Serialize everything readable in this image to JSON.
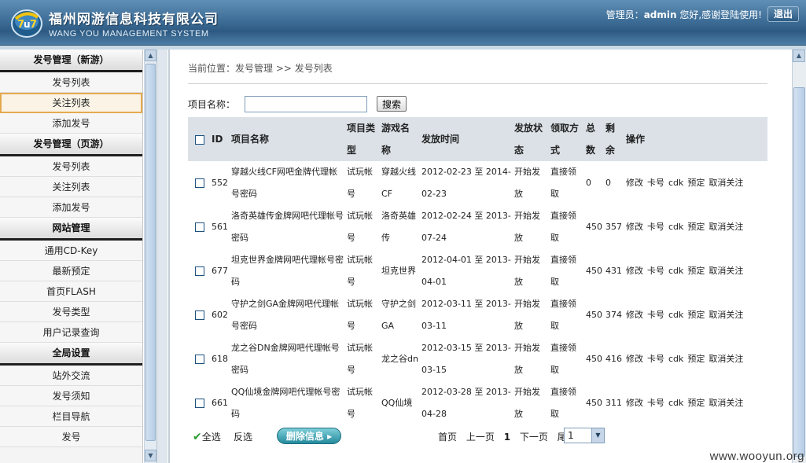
{
  "header": {
    "title": "福州网游信息科技有限公司",
    "subtitle": "WANG YOU MANAGEMENT SYSTEM",
    "admin_prefix": "管理员：",
    "admin_name": "admin",
    "admin_suffix": " 您好,感谢登陆使用!",
    "logout_label": "退出"
  },
  "sidebar": {
    "sections": [
      {
        "title": "发号管理（新游）",
        "items": [
          "发号列表",
          "关注列表",
          "添加发号"
        ]
      },
      {
        "title": "发号管理（页游）",
        "items": [
          "发号列表",
          "关注列表",
          "添加发号"
        ]
      },
      {
        "title": "网站管理",
        "items": [
          "通用CD-Key",
          "最新预定",
          "首页FLASH",
          "发号类型",
          "用户记录查询"
        ]
      },
      {
        "title": "全局设置",
        "items": [
          "站外交流",
          "发号须知",
          "栏目导航",
          "发号"
        ]
      }
    ],
    "active_item": "关注列表"
  },
  "main": {
    "breadcrumb": "当前位置：发号管理 >> 发号列表",
    "search_label": "项目名称：",
    "search_value": "",
    "search_button": "搜索",
    "columns": {
      "id": "ID",
      "name": "项目名称",
      "type": "项目类型",
      "game": "游戏名称",
      "time": "发放时间",
      "status": "发放状态",
      "method": "领取方式",
      "total": "总数",
      "remain": "剩余",
      "ops": "操作"
    },
    "rows": [
      {
        "id": "552",
        "name": "穿越火线CF网吧金牌代理帐号密码",
        "type": "试玩帐号",
        "game": "穿越火线CF",
        "time": "2012-02-23 至 2014-02-23",
        "status": "开始发放",
        "method": "直接领取",
        "total": "0",
        "remain": "0"
      },
      {
        "id": "561",
        "name": "洛奇英雄传金牌网吧代理帐号密码",
        "type": "试玩帐号",
        "game": "洛奇英雄传",
        "time": "2012-02-24 至 2013-07-24",
        "status": "开始发放",
        "method": "直接领取",
        "total": "450",
        "remain": "357"
      },
      {
        "id": "677",
        "name": "坦克世界金牌网吧代理帐号密码",
        "type": "试玩帐号",
        "game": "坦克世界",
        "time": "2012-04-01 至 2013-04-01",
        "status": "开始发放",
        "method": "直接领取",
        "total": "450",
        "remain": "431"
      },
      {
        "id": "602",
        "name": "守护之剑GA金牌网吧代理帐号密码",
        "type": "试玩帐号",
        "game": "守护之剑GA",
        "time": "2012-03-11 至 2013-03-11",
        "status": "开始发放",
        "method": "直接领取",
        "total": "450",
        "remain": "374"
      },
      {
        "id": "618",
        "name": "龙之谷DN金牌网吧代理帐号密码",
        "type": "试玩帐号",
        "game": "龙之谷dn",
        "time": "2012-03-15 至 2013-03-15",
        "status": "开始发放",
        "method": "直接领取",
        "total": "450",
        "remain": "416"
      },
      {
        "id": "661",
        "name": "QQ仙境金牌网吧代理帐号密码",
        "type": "试玩帐号",
        "game": "QQ仙境",
        "time": "2012-03-28 至 2013-04-28",
        "status": "开始发放",
        "method": "直接领取",
        "total": "450",
        "remain": "311"
      }
    ],
    "row_ops": [
      "修改",
      "卡号",
      "cdk",
      "预定",
      "取消关注"
    ],
    "select_all": "全选",
    "invert_select": "反选",
    "delete_button": "删除信息 ▸",
    "pager": {
      "first": "首页",
      "prev": "上一页",
      "current": "1",
      "next": "下一页",
      "last": "尾页",
      "select_value": "1"
    }
  },
  "watermark": "www.wooyun.org"
}
